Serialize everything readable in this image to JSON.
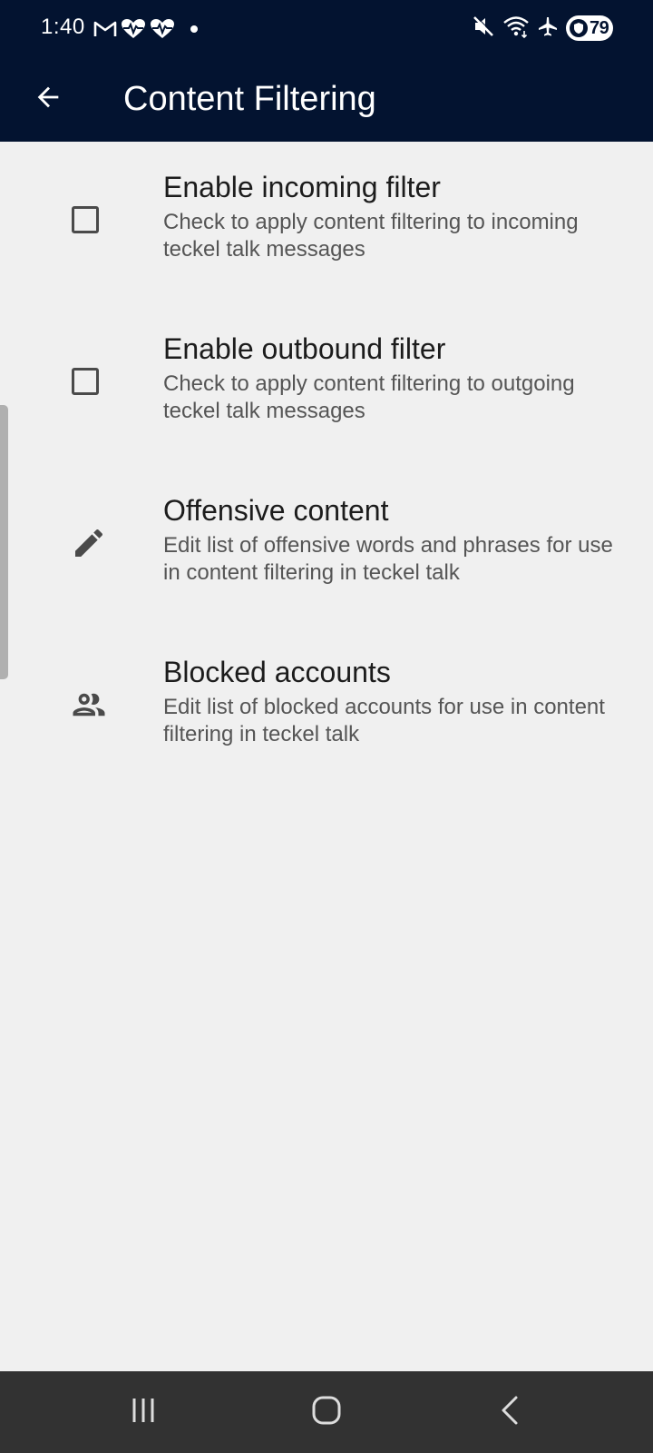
{
  "status_bar": {
    "time": "1:40",
    "battery_level": "79",
    "left_icons": [
      "gmail-icon",
      "health-heart-icon",
      "health-heart-icon",
      "notification-dot-icon"
    ],
    "right_icons": [
      "mute-icon",
      "wifi-icon",
      "airplane-mode-icon",
      "battery-icon"
    ]
  },
  "app_bar": {
    "title": "Content Filtering",
    "back_icon": "arrow-back-icon"
  },
  "settings": [
    {
      "id": "incoming-filter",
      "type": "checkbox",
      "checked": false,
      "title": "Enable incoming filter",
      "summary": "Check to apply content filtering to incoming teckel talk messages"
    },
    {
      "id": "outbound-filter",
      "type": "checkbox",
      "checked": false,
      "title": "Enable outbound filter",
      "summary": "Check to apply content filtering to outgoing teckel talk messages"
    },
    {
      "id": "offensive-content",
      "type": "link",
      "icon": "pencil-edit-icon",
      "title": "Offensive content",
      "summary": "Edit list of offensive words and phrases for use in content filtering in teckel talk"
    },
    {
      "id": "blocked-accounts",
      "type": "link",
      "icon": "people-icon",
      "title": "Blocked accounts",
      "summary": "Edit list of blocked accounts for use in content filtering in teckel talk"
    }
  ],
  "nav_bar": {
    "buttons": [
      "recent-apps-icon",
      "home-icon",
      "back-icon"
    ]
  },
  "colors": {
    "app_bar_background": "#031330",
    "page_background": "#f0f0f0",
    "nav_bar_background": "#323232",
    "title_text": "#1c1c1c",
    "summary_text": "#555555",
    "icon": "#4a4a4a"
  }
}
